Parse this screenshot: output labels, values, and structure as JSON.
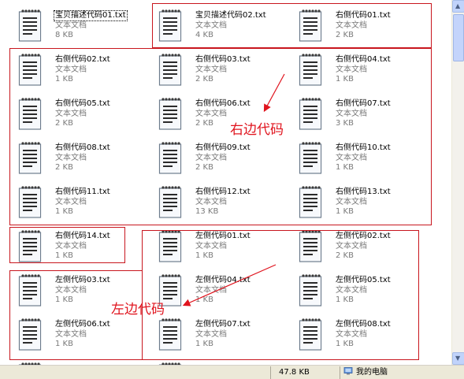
{
  "files": [
    {
      "name": "宝贝描述代码01.txt",
      "type": "文本文档",
      "size": "8 KB",
      "focused": true
    },
    {
      "name": "宝贝描述代码02.txt",
      "type": "文本文档",
      "size": "4 KB"
    },
    {
      "name": "右侧代码01.txt",
      "type": "文本文档",
      "size": "2 KB"
    },
    {
      "name": "右侧代码02.txt",
      "type": "文本文档",
      "size": "1 KB"
    },
    {
      "name": "右侧代码03.txt",
      "type": "文本文档",
      "size": "2 KB"
    },
    {
      "name": "右侧代码04.txt",
      "type": "文本文档",
      "size": "1 KB"
    },
    {
      "name": "右侧代码05.txt",
      "type": "文本文档",
      "size": "2 KB"
    },
    {
      "name": "右侧代码06.txt",
      "type": "文本文档",
      "size": "2 KB"
    },
    {
      "name": "右侧代码07.txt",
      "type": "文本文档",
      "size": "3 KB"
    },
    {
      "name": "右侧代码08.txt",
      "type": "文本文档",
      "size": "2 KB"
    },
    {
      "name": "右侧代码09.txt",
      "type": "文本文档",
      "size": "2 KB"
    },
    {
      "name": "右侧代码10.txt",
      "type": "文本文档",
      "size": "1 KB"
    },
    {
      "name": "右侧代码11.txt",
      "type": "文本文档",
      "size": "1 KB"
    },
    {
      "name": "右侧代码12.txt",
      "type": "文本文档",
      "size": "13 KB"
    },
    {
      "name": "右侧代码13.txt",
      "type": "文本文档",
      "size": "1 KB"
    },
    {
      "name": "右侧代码14.txt",
      "type": "文本文档",
      "size": "1 KB"
    },
    {
      "name": "左侧代码01.txt",
      "type": "文本文档",
      "size": "1 KB"
    },
    {
      "name": "左侧代码02.txt",
      "type": "文本文档",
      "size": "2 KB"
    },
    {
      "name": "左侧代码03.txt",
      "type": "文本文档",
      "size": "1 KB"
    },
    {
      "name": "左侧代码04.txt",
      "type": "文本文档",
      "size": "1 KB"
    },
    {
      "name": "左侧代码05.txt",
      "type": "文本文档",
      "size": "1 KB"
    },
    {
      "name": "左侧代码06.txt",
      "type": "文本文档",
      "size": "1 KB"
    },
    {
      "name": "左侧代码07.txt",
      "type": "文本文档",
      "size": "1 KB"
    },
    {
      "name": "左侧代码08.txt",
      "type": "文本文档",
      "size": "1 KB"
    }
  ],
  "annotations": {
    "right_label": "右边代码",
    "left_label": "左边代码",
    "color": "#e0141e"
  },
  "icons": {
    "file": "text-document-icon",
    "computer": "my-computer-icon"
  },
  "statusbar": {
    "size": "47.8 KB",
    "location": "我的电脑"
  }
}
